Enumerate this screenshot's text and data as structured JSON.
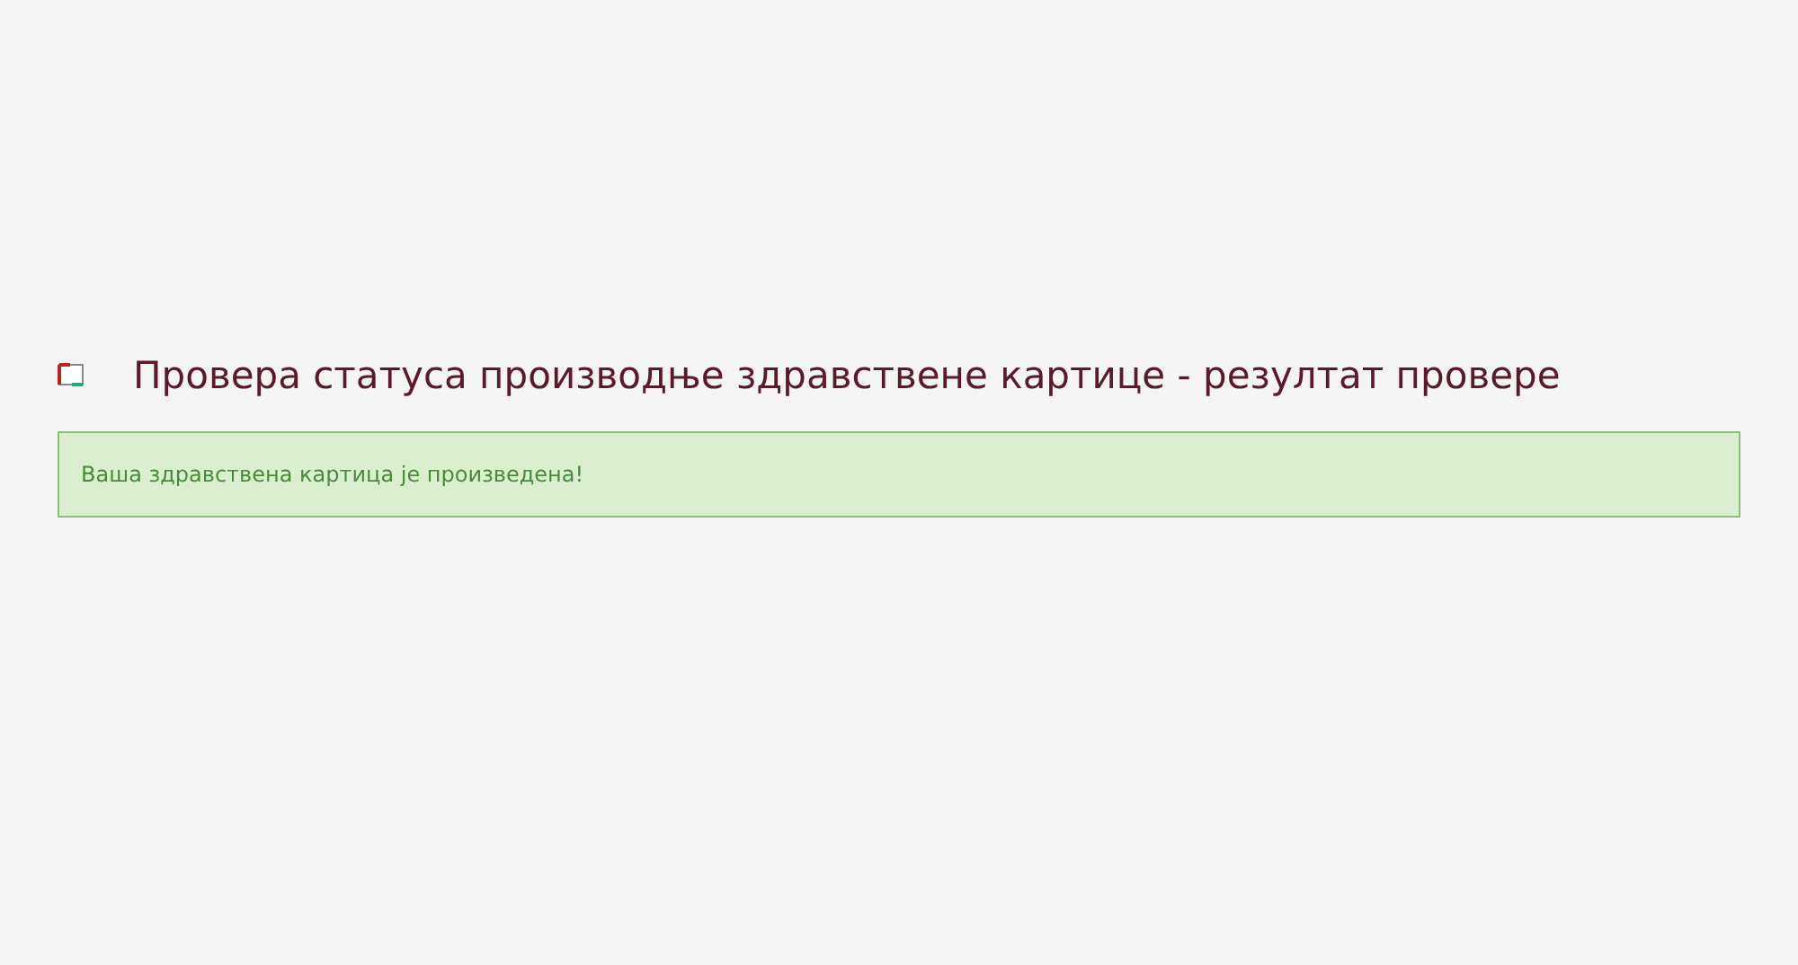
{
  "heading": {
    "title": "Провера статуса производње здравствене картице - резултат провере"
  },
  "message": {
    "kind": "success",
    "text": "Ваша здравствена картица је произведена!"
  }
}
